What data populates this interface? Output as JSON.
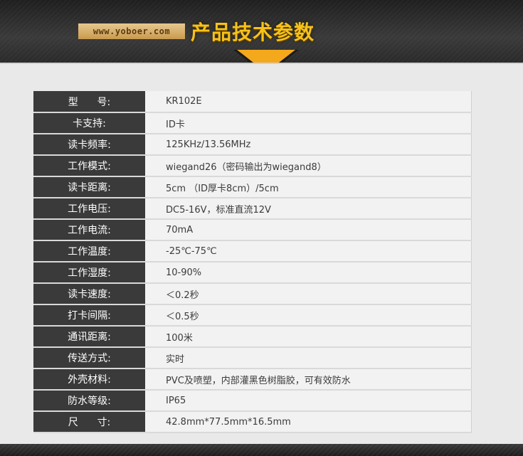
{
  "header": {
    "url": "www.yoboer.com",
    "title": "产品技术参数",
    "accent_color": "#f4a81c"
  },
  "specs": [
    {
      "label": "型      号:",
      "value": "KR102E"
    },
    {
      "label": "卡支持:",
      "value": "ID卡"
    },
    {
      "label": "读卡频率:",
      "value": "125KHz/13.56MHz"
    },
    {
      "label": "工作模式:",
      "value": "wiegand26（密码输出为wiegand8）"
    },
    {
      "label": "读卡距离:",
      "value": "5cm （ID厚卡8cm）/5cm"
    },
    {
      "label": "工作电压:",
      "value": "DC5-16V，标准直流12V"
    },
    {
      "label": "工作电流:",
      "value": "70mA"
    },
    {
      "label": "工作温度:",
      "value": "-25℃-75℃"
    },
    {
      "label": "工作湿度:",
      "value": "10-90%"
    },
    {
      "label": "读卡速度:",
      "value": "＜0.2秒"
    },
    {
      "label": "打卡间隔:",
      "value": "＜0.5秒"
    },
    {
      "label": "通讯距离:",
      "value": "100米"
    },
    {
      "label": "传送方式:",
      "value": "实时"
    },
    {
      "label": "外壳材料:",
      "value": "PVC及喷塑，内部灌黑色树脂胶，可有效防水"
    },
    {
      "label": "防水等级:",
      "value": "IP65"
    },
    {
      "label": "尺      寸:",
      "value": "42.8mm*77.5mm*16.5mm"
    }
  ]
}
